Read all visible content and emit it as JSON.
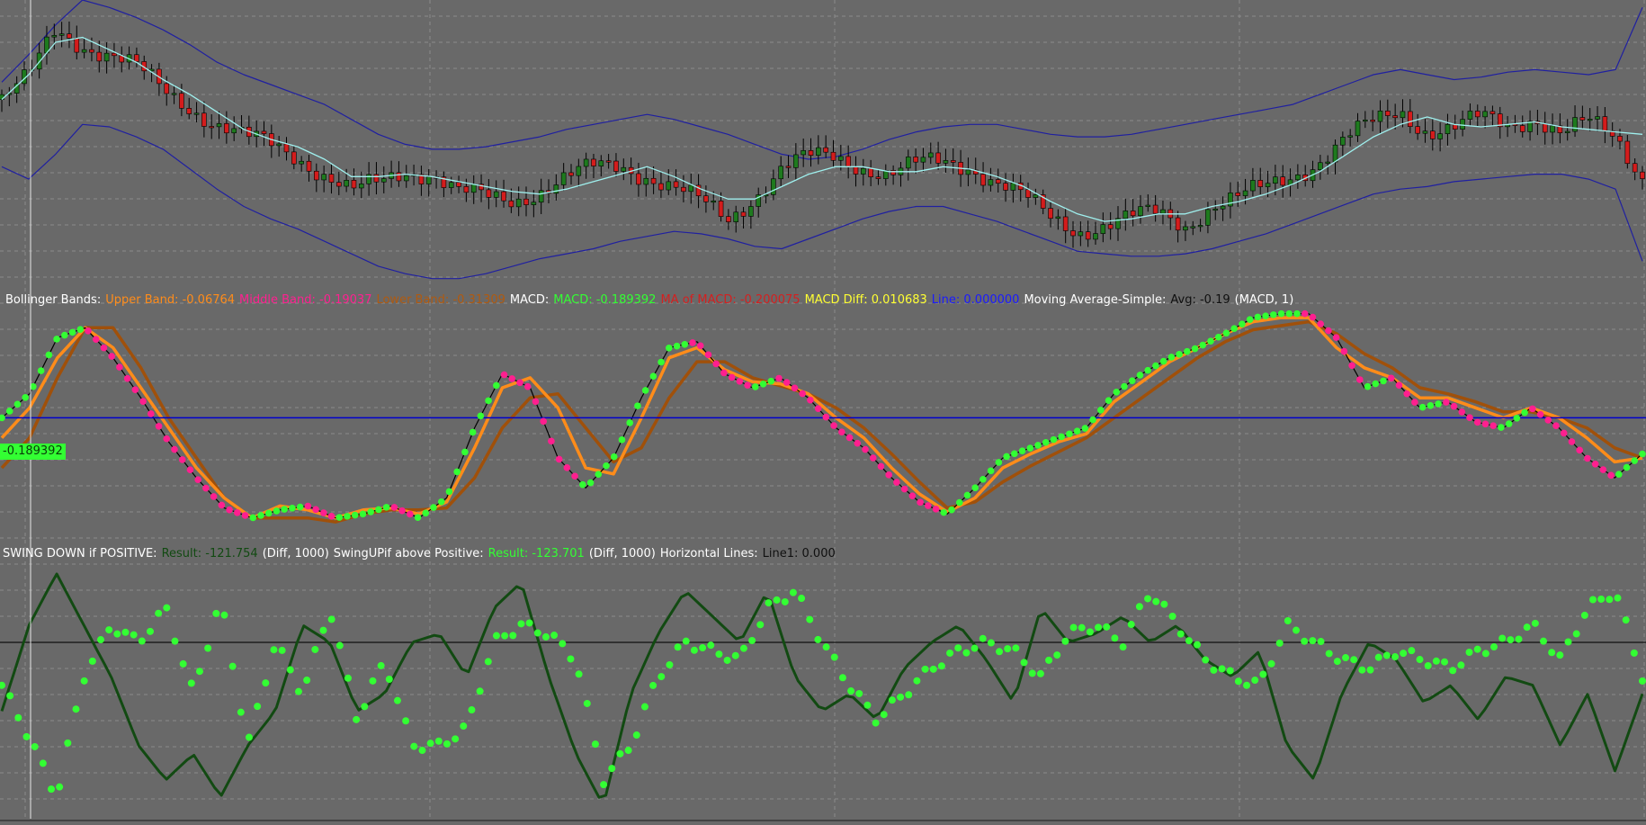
{
  "colors": {
    "background": "#696969",
    "grid": "#8c8c8c",
    "candle_up": "#1e7a1e",
    "candle_down": "#d41c1c",
    "wick": "#000000",
    "bb_band": "#2020a0",
    "bb_middle": "#9ff0ee",
    "macd_line": "#000000",
    "macd_up_dots": "#33ff33",
    "macd_down_dots": "#ff1f8f",
    "ma_of_macd": "#ff8c1a",
    "macd_slow": "#a0500a",
    "zero_line": "#0000cc",
    "swing_down": "#124a12",
    "swing_up": "#33ff33",
    "hline": "#101010",
    "label_white": "#ffffff",
    "upper_band": "#ff8c1a",
    "middle_band": "#ff2090",
    "lower_band": "#b05a10",
    "macd_text": "#33ff33",
    "ma_macd_text": "#d42020",
    "macd_diff_text": "#ffff33",
    "line_text": "#1a1aff",
    "avg_text": "#101010"
  },
  "legend_bb": [
    {
      "text": "Bollinger Bands:",
      "color": "#ffffff"
    },
    {
      "text": "Upper Band: -0.06764",
      "color": "#ff8c1a"
    },
    {
      "text": "Middle Band: -0.19037",
      "color": "#ff2090"
    },
    {
      "text": "Lower Band: -0.31309",
      "color": "#b05a10"
    },
    {
      "text": "MACD:",
      "color": "#ffffff"
    },
    {
      "text": "MACD: -0.189392",
      "color": "#33ff33"
    },
    {
      "text": "MA of MACD: -0.200075",
      "color": "#d42020"
    },
    {
      "text": "MACD Diff: 0.010683",
      "color": "#ffff33"
    },
    {
      "text": "Line: 0.000000",
      "color": "#1a1aff"
    },
    {
      "text": "Moving Average-Simple:",
      "color": "#ffffff"
    },
    {
      "text": "Avg: -0.19",
      "color": "#101010"
    },
    {
      "text": "(MACD, 1)",
      "color": "#ffffff"
    }
  ],
  "legend_swing": [
    {
      "text": "SWING DOWN if POSITIVE:",
      "color": "#ffffff"
    },
    {
      "text": "Result: -121.754",
      "color": "#124a12"
    },
    {
      "text": "(Diff, 1000)",
      "color": "#ffffff"
    },
    {
      "text": "SwingUPif above Positive:",
      "color": "#ffffff"
    },
    {
      "text": "Result: -123.701",
      "color": "#33ff33"
    },
    {
      "text": "(Diff, 1000)",
      "color": "#ffffff"
    },
    {
      "text": "Horizontal Lines:",
      "color": "#ffffff"
    },
    {
      "text": "Line1: 0.000",
      "color": "#101010"
    }
  ],
  "macd_price_tag": "-0.189392",
  "chart_data": [
    {
      "type": "candlestick",
      "name": "price",
      "series": [
        {
          "name": "Upper Band",
          "values": [
            0.67,
            0.78,
            0.9,
            1.0,
            0.97,
            0.93,
            0.88,
            0.82,
            0.75,
            0.7,
            0.66,
            0.62,
            0.58,
            0.52,
            0.46,
            0.42,
            0.4,
            0.4,
            0.41,
            0.43,
            0.45,
            0.48,
            0.5,
            0.52,
            0.54,
            0.52,
            0.49,
            0.46,
            0.42,
            0.38,
            0.36,
            0.37,
            0.4,
            0.44,
            0.47,
            0.49,
            0.5,
            0.5,
            0.48,
            0.46,
            0.45,
            0.45,
            0.46,
            0.48,
            0.5,
            0.52,
            0.54,
            0.56,
            0.58,
            0.62,
            0.66,
            0.7,
            0.72,
            0.7,
            0.68,
            0.69,
            0.71,
            0.72,
            0.71,
            0.7,
            0.72,
            0.97
          ]
        },
        {
          "name": "Middle Band",
          "values": [
            0.6,
            0.7,
            0.83,
            0.85,
            0.8,
            0.75,
            0.68,
            0.62,
            0.55,
            0.48,
            0.44,
            0.41,
            0.36,
            0.29,
            0.29,
            0.3,
            0.29,
            0.27,
            0.25,
            0.23,
            0.22,
            0.24,
            0.27,
            0.3,
            0.33,
            0.29,
            0.24,
            0.2,
            0.2,
            0.25,
            0.3,
            0.33,
            0.33,
            0.31,
            0.31,
            0.33,
            0.32,
            0.29,
            0.25,
            0.19,
            0.14,
            0.11,
            0.12,
            0.14,
            0.14,
            0.17,
            0.19,
            0.22,
            0.26,
            0.31,
            0.38,
            0.45,
            0.5,
            0.53,
            0.5,
            0.49,
            0.5,
            0.51,
            0.49,
            0.48,
            0.47,
            0.46
          ]
        },
        {
          "name": "Lower Band",
          "values": [
            0.33,
            0.28,
            0.38,
            0.5,
            0.49,
            0.45,
            0.4,
            0.32,
            0.24,
            0.17,
            0.12,
            0.08,
            0.03,
            -0.02,
            -0.07,
            -0.1,
            -0.12,
            -0.12,
            -0.1,
            -0.07,
            -0.04,
            -0.02,
            0.0,
            0.03,
            0.05,
            0.07,
            0.06,
            0.04,
            0.01,
            0.0,
            0.04,
            0.08,
            0.12,
            0.15,
            0.17,
            0.17,
            0.14,
            0.11,
            0.07,
            0.03,
            -0.01,
            -0.02,
            -0.03,
            -0.03,
            -0.02,
            0.0,
            0.03,
            0.06,
            0.1,
            0.14,
            0.18,
            0.22,
            0.24,
            0.25,
            0.27,
            0.28,
            0.29,
            0.3,
            0.3,
            0.28,
            0.24,
            -0.05
          ]
        },
        {
          "name": "Close",
          "values": [
            0.6,
            0.68,
            0.88,
            0.83,
            0.78,
            0.72,
            0.64,
            0.58,
            0.5,
            0.44,
            0.42,
            0.38,
            0.3,
            0.22,
            0.26,
            0.32,
            0.31,
            0.22,
            0.2,
            0.2,
            0.24,
            0.28,
            0.32,
            0.34,
            0.3,
            0.24,
            0.18,
            0.12,
            0.22,
            0.32,
            0.36,
            0.37,
            0.34,
            0.3,
            0.33,
            0.35,
            0.34,
            0.27,
            0.2,
            0.12,
            0.08,
            0.1,
            0.12,
            0.14,
            0.1,
            0.18,
            0.2,
            0.24,
            0.3,
            0.36,
            0.44,
            0.5,
            0.56,
            0.48,
            0.48,
            0.52,
            0.5,
            0.54,
            0.46,
            0.5,
            0.45,
            0.3
          ]
        }
      ]
    },
    {
      "type": "line",
      "name": "macd",
      "zero_line": 0.0,
      "series": [
        {
          "name": "MACD",
          "values": [
            0.0,
            0.12,
            0.4,
            0.45,
            0.3,
            0.1,
            -0.12,
            -0.3,
            -0.45,
            -0.5,
            -0.46,
            -0.44,
            -0.5,
            -0.48,
            -0.44,
            -0.5,
            -0.4,
            -0.05,
            0.22,
            0.15,
            -0.2,
            -0.35,
            -0.2,
            0.1,
            0.35,
            0.38,
            0.22,
            0.15,
            0.2,
            0.1,
            -0.05,
            -0.15,
            -0.3,
            -0.42,
            -0.48,
            -0.35,
            -0.2,
            -0.15,
            -0.1,
            -0.05,
            0.12,
            0.22,
            0.3,
            0.35,
            0.42,
            0.5,
            0.52,
            0.52,
            0.4,
            0.15,
            0.2,
            0.05,
            0.08,
            -0.02,
            -0.05,
            0.05,
            -0.05,
            -0.2,
            -0.3,
            -0.18
          ]
        },
        {
          "name": "MA of MACD",
          "values": [
            -0.1,
            0.05,
            0.3,
            0.45,
            0.35,
            0.15,
            -0.05,
            -0.25,
            -0.4,
            -0.5,
            -0.44,
            -0.46,
            -0.5,
            -0.46,
            -0.45,
            -0.48,
            -0.42,
            -0.15,
            0.15,
            0.2,
            0.05,
            -0.25,
            -0.28,
            0.0,
            0.3,
            0.35,
            0.24,
            0.18,
            0.17,
            0.12,
            0.0,
            -0.1,
            -0.25,
            -0.38,
            -0.47,
            -0.4,
            -0.25,
            -0.18,
            -0.12,
            -0.08,
            0.08,
            0.18,
            0.28,
            0.35,
            0.42,
            0.48,
            0.5,
            0.5,
            0.35,
            0.25,
            0.2,
            0.1,
            0.1,
            0.05,
            0.0,
            0.05,
            0.0,
            -0.1,
            -0.22,
            -0.2
          ]
        },
        {
          "name": "Moving Average-Simple",
          "values": [
            -0.25,
            -0.1,
            0.2,
            0.45,
            0.45,
            0.25,
            0.0,
            -0.2,
            -0.4,
            -0.5,
            -0.5,
            -0.5,
            -0.52,
            -0.48,
            -0.46,
            -0.46,
            -0.45,
            -0.3,
            -0.05,
            0.1,
            0.12,
            -0.05,
            -0.22,
            -0.15,
            0.1,
            0.28,
            0.28,
            0.2,
            0.16,
            0.12,
            0.05,
            -0.05,
            -0.18,
            -0.32,
            -0.45,
            -0.42,
            -0.32,
            -0.24,
            -0.17,
            -0.1,
            0.0,
            0.1,
            0.2,
            0.3,
            0.38,
            0.44,
            0.46,
            0.48,
            0.42,
            0.32,
            0.25,
            0.15,
            0.12,
            0.08,
            0.03,
            0.03,
            0.0,
            -0.05,
            -0.15,
            -0.2
          ]
        }
      ]
    },
    {
      "type": "line",
      "name": "swing",
      "hline": 0.0,
      "series": [
        {
          "name": "SWING DOWN if POSITIVE",
          "values": [
            -0.4,
            0.1,
            0.4,
            0.1,
            -0.2,
            -0.6,
            -0.8,
            -0.65,
            -0.9,
            -0.6,
            -0.4,
            0.1,
            0.0,
            -0.4,
            -0.3,
            0.0,
            0.05,
            -0.2,
            0.2,
            0.35,
            -0.2,
            -0.65,
            -0.95,
            -0.3,
            0.05,
            0.3,
            0.15,
            0.0,
            0.3,
            -0.2,
            -0.4,
            -0.3,
            -0.45,
            -0.15,
            0.0,
            0.1,
            -0.1,
            -0.35,
            0.2,
            0.0,
            0.05,
            0.15,
            0.0,
            0.1,
            -0.1,
            -0.2,
            -0.05,
            -0.6,
            -0.8,
            -0.3,
            0.0,
            -0.1,
            -0.35,
            -0.25,
            -0.45,
            -0.2,
            -0.25,
            -0.6,
            -0.3,
            -0.75,
            -0.3
          ]
        },
        {
          "name": "SwingUPif above Positive",
          "values": [
            -0.25,
            -0.55,
            -0.9,
            -0.2,
            0.1,
            0.0,
            0.2,
            -0.3,
            0.25,
            -0.6,
            0.0,
            -0.3,
            0.2,
            -0.45,
            -0.1,
            -0.6,
            -0.6,
            -0.5,
            0.0,
            0.1,
            0.05,
            -0.1,
            -0.8,
            -0.6,
            -0.2,
            0.0,
            -0.05,
            -0.1,
            0.2,
            0.3,
            0.0,
            -0.25,
            -0.45,
            -0.3,
            -0.15,
            -0.05,
            0.0,
            -0.05,
            -0.2,
            0.05,
            0.1,
            0.0,
            0.3,
            0.1,
            -0.1,
            -0.2,
            -0.25,
            0.1,
            0.0,
            -0.1,
            -0.15,
            -0.05,
            -0.1,
            -0.15,
            -0.05,
            0.0,
            0.1,
            -0.1,
            0.2,
            0.3,
            -0.2
          ]
        }
      ]
    }
  ]
}
